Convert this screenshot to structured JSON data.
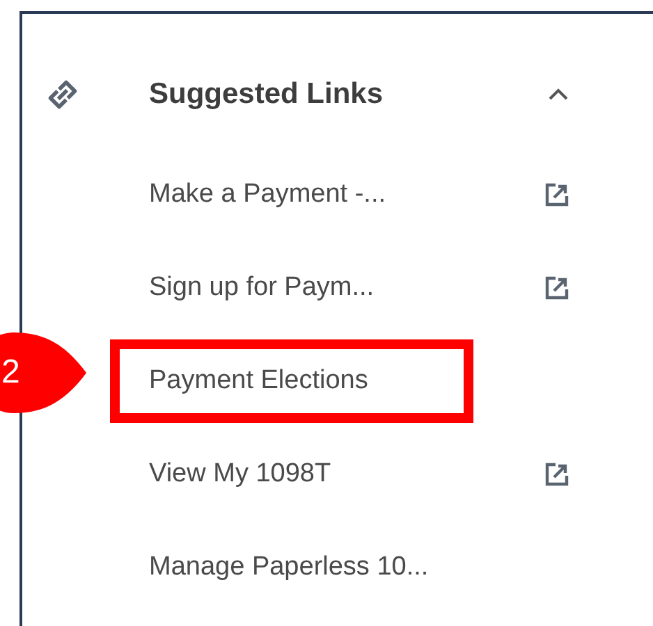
{
  "section": {
    "title": "Suggested Links",
    "expanded": true
  },
  "links": [
    {
      "label": "Make a Payment -...",
      "external": true,
      "highlighted": false
    },
    {
      "label": "Sign up for Paym...",
      "external": true,
      "highlighted": false
    },
    {
      "label": "Payment Elections",
      "external": false,
      "highlighted": true
    },
    {
      "label": "View My 1098T",
      "external": true,
      "highlighted": false
    },
    {
      "label": "Manage Paperless 10...",
      "external": false,
      "highlighted": false
    }
  ],
  "callout": {
    "label": "2"
  }
}
